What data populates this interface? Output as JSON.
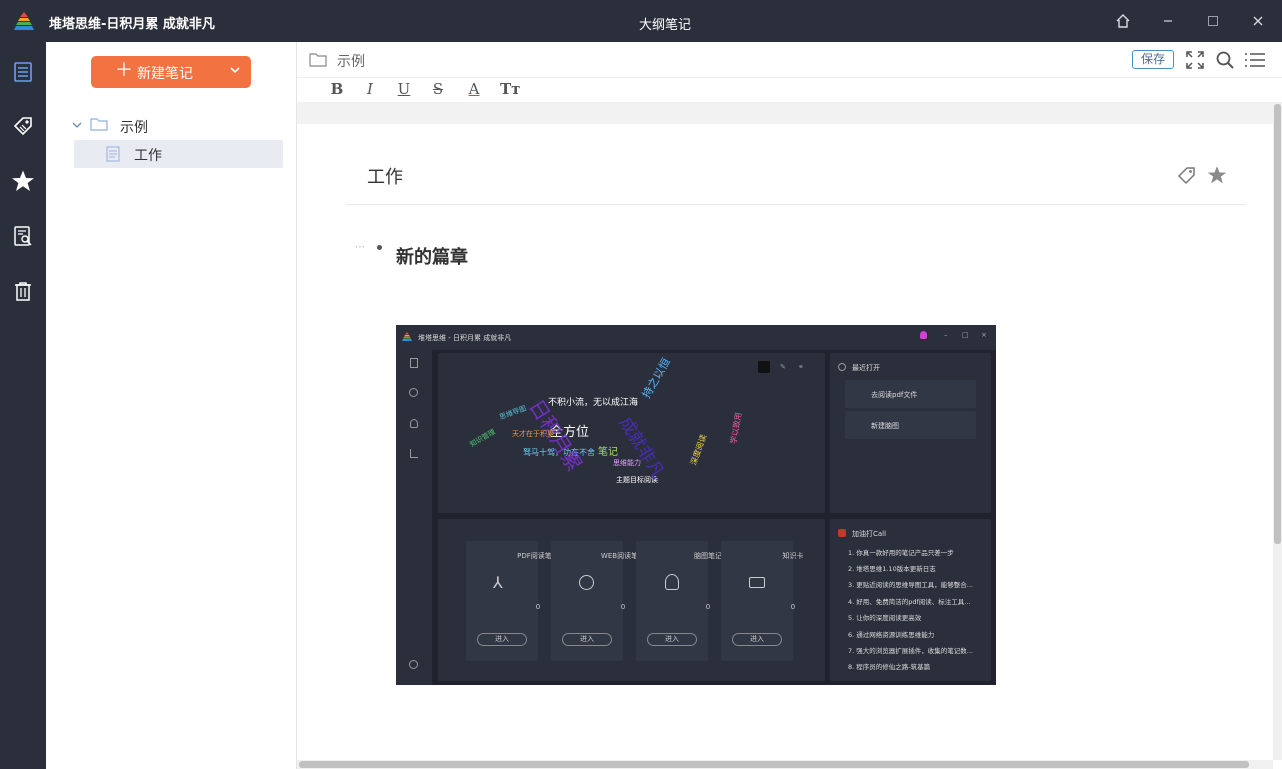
{
  "titlebar": {
    "app_title": "堆塔思维-日积月累 成就非凡",
    "center_title": "大纲笔记"
  },
  "sidebar": {
    "new_note_label": "新建笔记",
    "tree": [
      {
        "label": "示例",
        "type": "folder"
      },
      {
        "label": "工作",
        "type": "note",
        "selected": true
      }
    ]
  },
  "toolbar": {
    "breadcrumb": "示例",
    "save_label": "保存"
  },
  "format": {
    "bold": "B",
    "italic": "I",
    "underline": "U",
    "strike": "S",
    "color": "A",
    "size": "Tт"
  },
  "note": {
    "title": "工作",
    "dots": "⋯",
    "heading": "新的篇章"
  },
  "embedded": {
    "title": "堆塔思维 - 日积月累 成就非凡",
    "recent_title": "最近打开",
    "recent": [
      "去阅读pdf文件",
      "新建脑图"
    ],
    "cards": [
      {
        "name": "PDF阅读笔记",
        "count": "0",
        "button": "进入"
      },
      {
        "name": "WEB阅读笔记",
        "count": "0",
        "button": "进入"
      },
      {
        "name": "脑图笔记",
        "count": "0",
        "button": "进入"
      },
      {
        "name": "知识卡",
        "count": "0",
        "button": "进入"
      }
    ],
    "news_title": "加油打Call",
    "news": [
      "1. 你真一款好用的笔记产品只差一步",
      "2. 堆塔思维1.10版本更新日志",
      "3. 更贴近阅读的思维导图工具，能够整合...",
      "4. 好用、免费简洁的pdf阅读、标注工具...",
      "5. 让你的深度阅读更高效",
      "6. 通过网络资源训练思维能力",
      "7. 强大的浏览器扩展插件，收集的笔记数...",
      "8. 程序员的修仙之路-筑基篇"
    ],
    "words": [
      {
        "text": "全方位",
        "color": "#ffffff"
      },
      {
        "text": "不积小流，无以成江海",
        "color": "#ffffff"
      },
      {
        "text": "驽马十驾，功在不舍",
        "color": "#6fd0ff"
      },
      {
        "text": "主题目标阅读",
        "color": "#ffffff"
      },
      {
        "text": "思维能力",
        "color": "#e0a0ff"
      },
      {
        "text": "日积月累",
        "color": "#7b2fd6"
      },
      {
        "text": "成就非凡",
        "color": "#4a2bbf"
      },
      {
        "text": "持之以恒",
        "color": "#55b7ff"
      },
      {
        "text": "深度阅读",
        "color": "#f2d64b"
      },
      {
        "text": "天才在于积累",
        "color": "#f09a3e"
      },
      {
        "text": "知识管理",
        "color": "#4ecb71"
      },
      {
        "text": "学以致用",
        "color": "#f25a9e"
      },
      {
        "text": "思维导图",
        "color": "#59c1d9"
      },
      {
        "text": "笔记",
        "color": "#a0e05a"
      }
    ]
  },
  "colors": {
    "accent": "#f27242",
    "chrome": "#2b2f3b"
  }
}
